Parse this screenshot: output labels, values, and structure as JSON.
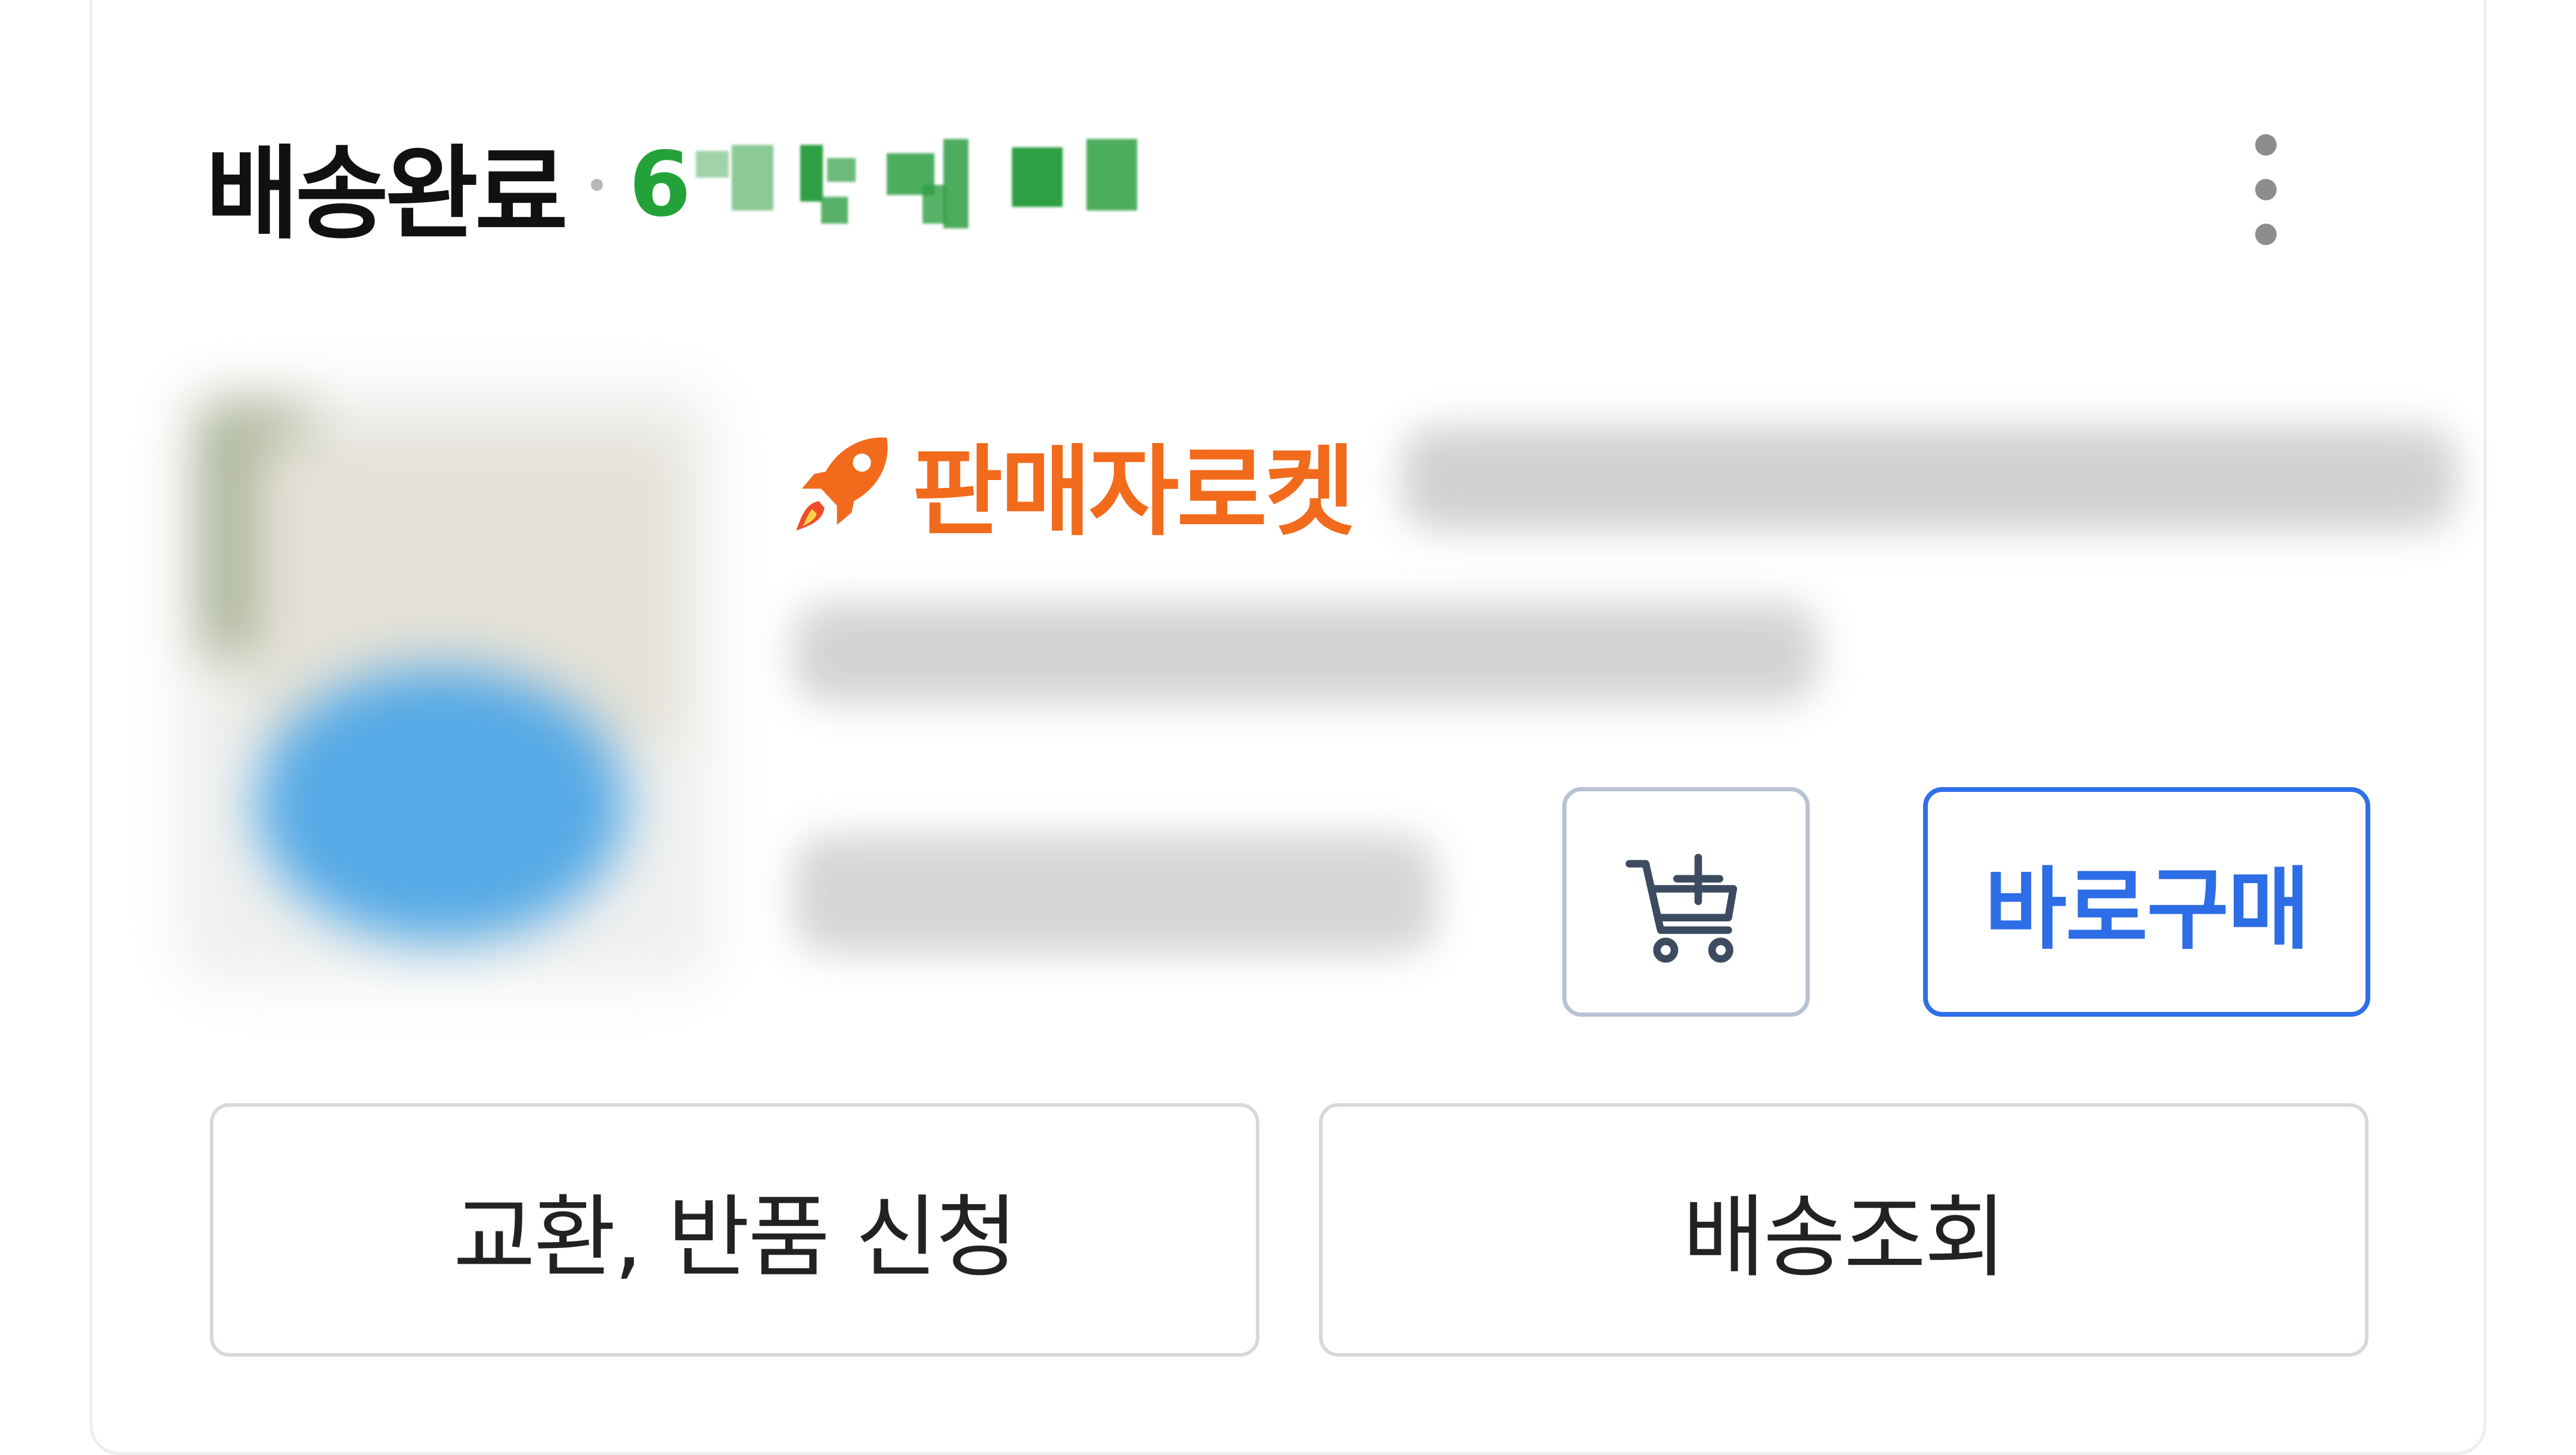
{
  "order": {
    "status": "배송완료",
    "date_visible": "6",
    "menu_icon": "kebab-menu-icon"
  },
  "product": {
    "badge": {
      "icon": "rocket-icon",
      "label": "판매자로켓"
    }
  },
  "actions": {
    "cart_icon": "add-to-cart-icon",
    "buy_now": "바로구매",
    "exchange_return": "교환, 반품 신청",
    "track_delivery": "배송조회"
  },
  "colors": {
    "status_date": "#23a23a",
    "badge_orange": "#f26a1c",
    "primary_blue": "#2d6de6",
    "card_border": "#eceef1"
  }
}
